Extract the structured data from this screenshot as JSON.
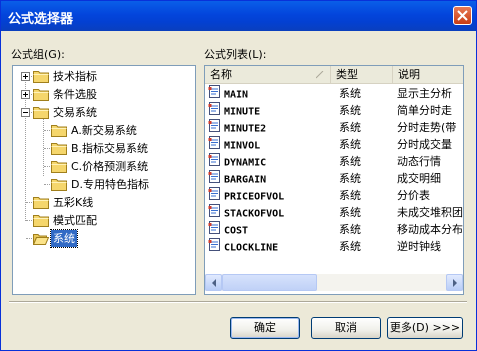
{
  "dialog": {
    "title": "公式选择器"
  },
  "tree": {
    "label": "公式组(G):",
    "items": [
      {
        "label": "技术指标",
        "level": 0,
        "expander": "plus"
      },
      {
        "label": "条件选股",
        "level": 0,
        "expander": "plus"
      },
      {
        "label": "交易系统",
        "level": 0,
        "expander": "minus"
      },
      {
        "label": "A.新交易系统",
        "level": 1
      },
      {
        "label": "B.指标交易系统",
        "level": 1
      },
      {
        "label": "C.价格预测系统",
        "level": 1
      },
      {
        "label": "D.专用特色指标",
        "level": 1
      },
      {
        "label": "五彩K线",
        "level": 0
      },
      {
        "label": "模式匹配",
        "level": 0
      },
      {
        "label": "系统",
        "level": 0,
        "selected": true,
        "open": true
      }
    ]
  },
  "list": {
    "label": "公式列表(L):",
    "columns": [
      "名称",
      "类型",
      "说明"
    ],
    "rows": [
      {
        "name": "MAIN",
        "type": "系统",
        "desc": "显示主分析"
      },
      {
        "name": "MINUTE",
        "type": "系统",
        "desc": "简单分时走"
      },
      {
        "name": "MINUTE2",
        "type": "系统",
        "desc": "分时走势(带"
      },
      {
        "name": "MINVOL",
        "type": "系统",
        "desc": "分时成交量"
      },
      {
        "name": "DYNAMIC",
        "type": "系统",
        "desc": "动态行情"
      },
      {
        "name": "BARGAIN",
        "type": "系统",
        "desc": "成交明细"
      },
      {
        "name": "PRICEOFVOL",
        "type": "系统",
        "desc": "分价表"
      },
      {
        "name": "STACKOFVOL",
        "type": "系统",
        "desc": "未成交堆积团"
      },
      {
        "name": "COST",
        "type": "系统",
        "desc": "移动成本分布"
      },
      {
        "name": "CLOCKLINE",
        "type": "系统",
        "desc": "逆时钟线"
      }
    ]
  },
  "buttons": {
    "ok": "确定",
    "cancel": "取消",
    "more": "更多(D) >>>"
  },
  "icons": {
    "close": "close-icon",
    "folder": "folder-icon",
    "formula": "formula-icon"
  },
  "colors": {
    "title_bar": "#0345dc",
    "selection": "#316ac5",
    "dialog_bg": "#ece9d8"
  }
}
